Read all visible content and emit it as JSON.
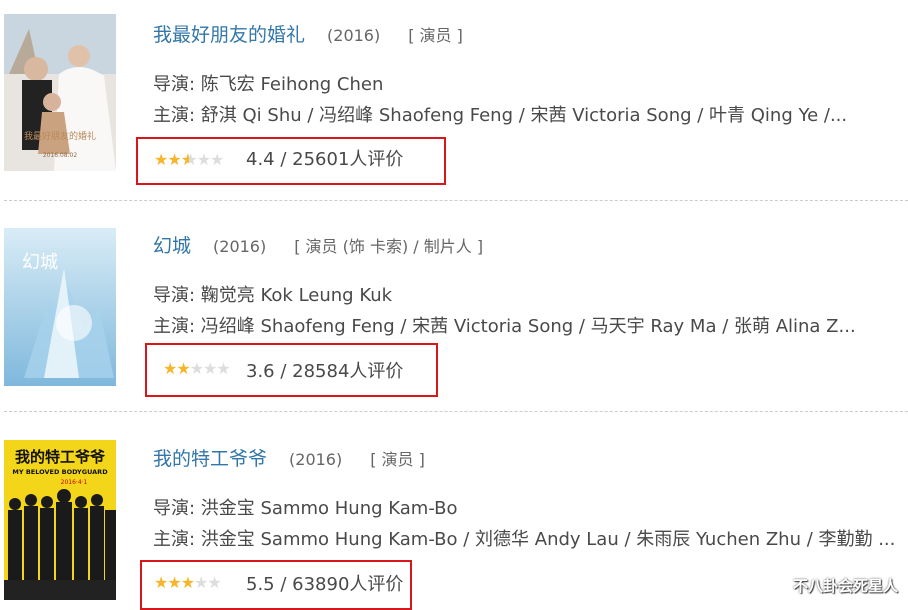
{
  "items": [
    {
      "title": "我最好朋友的婚礼",
      "year": "(2016)",
      "roles": "[ 演员 ]",
      "director": "导演: 陈飞宏 Feihong Chen",
      "cast": "主演: 舒淇 Qi Shu / 冯绍峰 Shaofeng Feng / 宋茜 Victoria Song / 叶青 Qing Ye /...",
      "rating_stars": 2.5,
      "rating_text": "4.4 / 25601人评价",
      "poster_text": "我最好朋友的婚礼",
      "poster_date": "2016.08.02"
    },
    {
      "title": "幻城",
      "year": "(2016)",
      "roles": "[ 演员 (饰 卡索) / 制片人 ]",
      "director": "导演: 鞠觉亮 Kok Leung Kuk",
      "cast": "主演: 冯绍峰 Shaofeng Feng / 宋茜 Victoria Song / 马天宇 Ray Ma / 张萌 Alina Z...",
      "rating_stars": 2,
      "rating_text": "3.6 / 28584人评价",
      "poster_text": "幻城",
      "poster_date": ""
    },
    {
      "title": "我的特工爷爷",
      "year": "(2016)",
      "roles": "[ 演员 ]",
      "director": "导演: 洪金宝 Sammo Hung Kam-Bo",
      "cast": "主演: 洪金宝 Sammo Hung Kam-Bo / 刘德华 Andy Lau / 朱雨辰 Yuchen Zhu / 李勤勤 ...",
      "rating_stars": 3,
      "rating_text": "5.5 / 63890人评价",
      "poster_text": "我的特工爷爷",
      "poster_subtitle": "MY BELOVED BODYGUARD",
      "poster_date": "2016·4·1"
    }
  ],
  "watermark": "不八卦会死星人",
  "colors": {
    "title": "#3377aa",
    "highlight_box": "#d8161b",
    "star": "#f7b52b",
    "star_empty": "#dddddd"
  }
}
